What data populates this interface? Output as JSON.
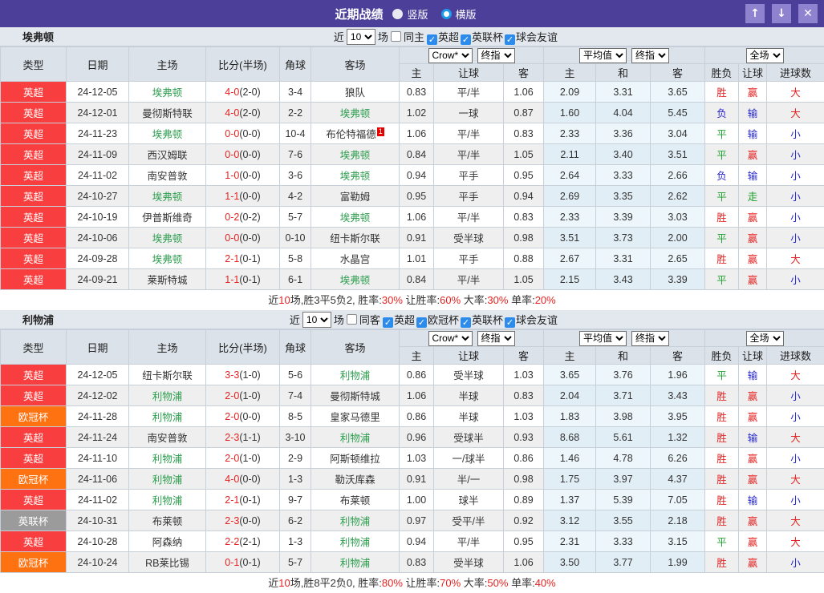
{
  "icons": {
    "check": "✓",
    "up": "↑",
    "down": "↓",
    "close": "✕"
  },
  "titlebar": {
    "title": "近期战绩",
    "radios": [
      {
        "label": "竖版",
        "selected": false
      },
      {
        "label": "横版",
        "selected": true
      }
    ],
    "buttons": {
      "up": "↑",
      "down": "↓",
      "close": "✕"
    }
  },
  "table_headers": {
    "left": [
      "类型",
      "日期",
      "主场",
      "比分(半场)",
      "角球",
      "客场"
    ],
    "odds_group": {
      "dropdown1": "Crow*",
      "dropdown2": "终指",
      "cols": [
        "主",
        "让球",
        "客"
      ]
    },
    "avg_group": {
      "dropdown1": "平均值",
      "dropdown2": "终指",
      "cols": [
        "主",
        "和",
        "客"
      ]
    },
    "result_group": {
      "dropdown": "全场",
      "cols": [
        "胜负",
        "让球",
        "进球数"
      ]
    }
  },
  "sections": [
    {
      "team": "埃弗顿",
      "controls": {
        "near_label": "近",
        "games": "10",
        "games_suffix": "场",
        "same_label": "同主",
        "same_checked": false,
        "leagues": [
          {
            "label": "英超",
            "checked": true
          },
          {
            "label": "英联杯",
            "checked": true
          },
          {
            "label": "球会友谊",
            "checked": true
          }
        ]
      },
      "rows": [
        {
          "league": "英超",
          "color": "red",
          "date": "24-12-05",
          "home": "埃弗顿",
          "hf": true,
          "score": "4-0",
          "half": "(2-0)",
          "corner": "3-4",
          "away": "狼队",
          "af": false,
          "o1": "0.83",
          "h": "平/半",
          "o2": "1.06",
          "a1": "2.09",
          "a2": "3.31",
          "a3": "3.65",
          "r1": "胜",
          "c1": "r",
          "r2": "赢",
          "c2": "r",
          "r3": "大",
          "c3": "r"
        },
        {
          "league": "英超",
          "color": "red",
          "date": "24-12-01",
          "home": "曼彻斯特联",
          "hf": false,
          "score": "4-0",
          "half": "(2-0)",
          "corner": "2-2",
          "away": "埃弗顿",
          "af": true,
          "o1": "1.02",
          "h": "一球",
          "o2": "0.87",
          "a1": "1.60",
          "a2": "4.04",
          "a3": "5.45",
          "r1": "负",
          "c1": "b",
          "r2": "输",
          "c2": "b",
          "r3": "大",
          "c3": "r"
        },
        {
          "league": "英超",
          "color": "red",
          "date": "24-11-23",
          "home": "埃弗顿",
          "hf": true,
          "score": "0-0",
          "half": "(0-0)",
          "corner": "10-4",
          "away": "布伦特福德",
          "af": false,
          "ab": "1",
          "o1": "1.06",
          "h": "平/半",
          "o2": "0.83",
          "a1": "2.33",
          "a2": "3.36",
          "a3": "3.04",
          "r1": "平",
          "c1": "g",
          "r2": "输",
          "c2": "b",
          "r3": "小",
          "c3": "b"
        },
        {
          "league": "英超",
          "color": "red",
          "date": "24-11-09",
          "home": "西汉姆联",
          "hf": false,
          "score": "0-0",
          "half": "(0-0)",
          "corner": "7-6",
          "away": "埃弗顿",
          "af": true,
          "o1": "0.84",
          "h": "平/半",
          "o2": "1.05",
          "a1": "2.11",
          "a2": "3.40",
          "a3": "3.51",
          "r1": "平",
          "c1": "g",
          "r2": "赢",
          "c2": "r",
          "r3": "小",
          "c3": "b"
        },
        {
          "league": "英超",
          "color": "red",
          "date": "24-11-02",
          "home": "南安普敦",
          "hf": false,
          "score": "1-0",
          "half": "(0-0)",
          "corner": "3-6",
          "away": "埃弗顿",
          "af": true,
          "o1": "0.94",
          "h": "平手",
          "o2": "0.95",
          "a1": "2.64",
          "a2": "3.33",
          "a3": "2.66",
          "r1": "负",
          "c1": "b",
          "r2": "输",
          "c2": "b",
          "r3": "小",
          "c3": "b"
        },
        {
          "league": "英超",
          "color": "red",
          "date": "24-10-27",
          "home": "埃弗顿",
          "hf": true,
          "score": "1-1",
          "half": "(0-0)",
          "corner": "4-2",
          "away": "富勒姆",
          "af": false,
          "o1": "0.95",
          "h": "平手",
          "o2": "0.94",
          "a1": "2.69",
          "a2": "3.35",
          "a3": "2.62",
          "r1": "平",
          "c1": "g",
          "r2": "走",
          "c2": "g",
          "r3": "小",
          "c3": "b"
        },
        {
          "league": "英超",
          "color": "red",
          "date": "24-10-19",
          "home": "伊普斯维奇",
          "hf": false,
          "score": "0-2",
          "half": "(0-2)",
          "corner": "5-7",
          "away": "埃弗顿",
          "af": true,
          "o1": "1.06",
          "h": "平/半",
          "o2": "0.83",
          "a1": "2.33",
          "a2": "3.39",
          "a3": "3.03",
          "r1": "胜",
          "c1": "r",
          "r2": "赢",
          "c2": "r",
          "r3": "小",
          "c3": "b"
        },
        {
          "league": "英超",
          "color": "red",
          "date": "24-10-06",
          "home": "埃弗顿",
          "hf": true,
          "score": "0-0",
          "half": "(0-0)",
          "corner": "0-10",
          "away": "纽卡斯尔联",
          "af": false,
          "o1": "0.91",
          "h": "受半球",
          "o2": "0.98",
          "a1": "3.51",
          "a2": "3.73",
          "a3": "2.00",
          "r1": "平",
          "c1": "g",
          "r2": "赢",
          "c2": "r",
          "r3": "小",
          "c3": "b"
        },
        {
          "league": "英超",
          "color": "red",
          "date": "24-09-28",
          "home": "埃弗顿",
          "hf": true,
          "score": "2-1",
          "half": "(0-1)",
          "corner": "5-8",
          "away": "水晶宫",
          "af": false,
          "o1": "1.01",
          "h": "平手",
          "o2": "0.88",
          "a1": "2.67",
          "a2": "3.31",
          "a3": "2.65",
          "r1": "胜",
          "c1": "r",
          "r2": "赢",
          "c2": "r",
          "r3": "大",
          "c3": "r"
        },
        {
          "league": "英超",
          "color": "red",
          "date": "24-09-21",
          "home": "莱斯特城",
          "hf": false,
          "score": "1-1",
          "half": "(0-1)",
          "corner": "6-1",
          "away": "埃弗顿",
          "af": true,
          "o1": "0.84",
          "h": "平/半",
          "o2": "1.05",
          "a1": "2.15",
          "a2": "3.43",
          "a3": "3.39",
          "r1": "平",
          "c1": "g",
          "r2": "赢",
          "c2": "r",
          "r3": "小",
          "c3": "b"
        }
      ],
      "summary": [
        [
          "近",
          "k"
        ],
        [
          "10",
          "r"
        ],
        [
          "场,胜3平5负2, 胜率:",
          "k"
        ],
        [
          "30%",
          "r"
        ],
        [
          " 让胜率:",
          "k"
        ],
        [
          "60%",
          "r"
        ],
        [
          " 大率:",
          "k"
        ],
        [
          "30%",
          "r"
        ],
        [
          " 单率:",
          "k"
        ],
        [
          "20%",
          "r"
        ]
      ]
    },
    {
      "team": "利物浦",
      "controls": {
        "near_label": "近",
        "games": "10",
        "games_suffix": "场",
        "same_label": "同客",
        "same_checked": false,
        "leagues": [
          {
            "label": "英超",
            "checked": true
          },
          {
            "label": "欧冠杯",
            "checked": true
          },
          {
            "label": "英联杯",
            "checked": true
          },
          {
            "label": "球会友谊",
            "checked": true
          }
        ]
      },
      "rows": [
        {
          "league": "英超",
          "color": "red",
          "date": "24-12-05",
          "home": "纽卡斯尔联",
          "hf": false,
          "score": "3-3",
          "half": "(1-0)",
          "corner": "5-6",
          "away": "利物浦",
          "af": true,
          "o1": "0.86",
          "h": "受半球",
          "o2": "1.03",
          "a1": "3.65",
          "a2": "3.76",
          "a3": "1.96",
          "r1": "平",
          "c1": "g",
          "r2": "输",
          "c2": "b",
          "r3": "大",
          "c3": "r"
        },
        {
          "league": "英超",
          "color": "red",
          "date": "24-12-02",
          "home": "利物浦",
          "hf": true,
          "score": "2-0",
          "half": "(1-0)",
          "corner": "7-4",
          "away": "曼彻斯特城",
          "af": false,
          "o1": "1.06",
          "h": "半球",
          "o2": "0.83",
          "a1": "2.04",
          "a2": "3.71",
          "a3": "3.43",
          "r1": "胜",
          "c1": "r",
          "r2": "赢",
          "c2": "r",
          "r3": "小",
          "c3": "b"
        },
        {
          "league": "欧冠杯",
          "color": "orange",
          "date": "24-11-28",
          "home": "利物浦",
          "hf": true,
          "score": "2-0",
          "half": "(0-0)",
          "corner": "8-5",
          "away": "皇家马德里",
          "af": false,
          "o1": "0.86",
          "h": "半球",
          "o2": "1.03",
          "a1": "1.83",
          "a2": "3.98",
          "a3": "3.95",
          "r1": "胜",
          "c1": "r",
          "r2": "赢",
          "c2": "r",
          "r3": "小",
          "c3": "b"
        },
        {
          "league": "英超",
          "color": "red",
          "date": "24-11-24",
          "home": "南安普敦",
          "hf": false,
          "score": "2-3",
          "half": "(1-1)",
          "corner": "3-10",
          "away": "利物浦",
          "af": true,
          "o1": "0.96",
          "h": "受球半",
          "o2": "0.93",
          "a1": "8.68",
          "a2": "5.61",
          "a3": "1.32",
          "r1": "胜",
          "c1": "r",
          "r2": "输",
          "c2": "b",
          "r3": "大",
          "c3": "r"
        },
        {
          "league": "英超",
          "color": "red",
          "date": "24-11-10",
          "home": "利物浦",
          "hf": true,
          "score": "2-0",
          "half": "(1-0)",
          "corner": "2-9",
          "away": "阿斯顿维拉",
          "af": false,
          "o1": "1.03",
          "h": "一/球半",
          "o2": "0.86",
          "a1": "1.46",
          "a2": "4.78",
          "a3": "6.26",
          "r1": "胜",
          "c1": "r",
          "r2": "赢",
          "c2": "r",
          "r3": "小",
          "c3": "b"
        },
        {
          "league": "欧冠杯",
          "color": "orange",
          "date": "24-11-06",
          "home": "利物浦",
          "hf": true,
          "score": "4-0",
          "half": "(0-0)",
          "corner": "1-3",
          "away": "勒沃库森",
          "af": false,
          "o1": "0.91",
          "h": "半/一",
          "o2": "0.98",
          "a1": "1.75",
          "a2": "3.97",
          "a3": "4.37",
          "r1": "胜",
          "c1": "r",
          "r2": "赢",
          "c2": "r",
          "r3": "大",
          "c3": "r"
        },
        {
          "league": "英超",
          "color": "red",
          "date": "24-11-02",
          "home": "利物浦",
          "hf": true,
          "score": "2-1",
          "half": "(0-1)",
          "corner": "9-7",
          "away": "布莱顿",
          "af": false,
          "o1": "1.00",
          "h": "球半",
          "o2": "0.89",
          "a1": "1.37",
          "a2": "5.39",
          "a3": "7.05",
          "r1": "胜",
          "c1": "r",
          "r2": "输",
          "c2": "b",
          "r3": "小",
          "c3": "b"
        },
        {
          "league": "英联杯",
          "color": "gray",
          "date": "24-10-31",
          "home": "布莱顿",
          "hf": false,
          "score": "2-3",
          "half": "(0-0)",
          "corner": "6-2",
          "away": "利物浦",
          "af": true,
          "o1": "0.97",
          "h": "受平/半",
          "o2": "0.92",
          "a1": "3.12",
          "a2": "3.55",
          "a3": "2.18",
          "r1": "胜",
          "c1": "r",
          "r2": "赢",
          "c2": "r",
          "r3": "大",
          "c3": "r"
        },
        {
          "league": "英超",
          "color": "red",
          "date": "24-10-28",
          "home": "阿森纳",
          "hf": false,
          "score": "2-2",
          "half": "(2-1)",
          "corner": "1-3",
          "away": "利物浦",
          "af": true,
          "o1": "0.94",
          "h": "平/半",
          "o2": "0.95",
          "a1": "2.31",
          "a2": "3.33",
          "a3": "3.15",
          "r1": "平",
          "c1": "g",
          "r2": "赢",
          "c2": "r",
          "r3": "大",
          "c3": "r"
        },
        {
          "league": "欧冠杯",
          "color": "orange",
          "date": "24-10-24",
          "home": "RB莱比锡",
          "hf": false,
          "score": "0-1",
          "half": "(0-1)",
          "corner": "5-7",
          "away": "利物浦",
          "af": true,
          "o1": "0.83",
          "h": "受半球",
          "o2": "1.06",
          "a1": "3.50",
          "a2": "3.77",
          "a3": "1.99",
          "r1": "胜",
          "c1": "r",
          "r2": "赢",
          "c2": "r",
          "r3": "小",
          "c3": "b"
        }
      ],
      "summary": [
        [
          "近",
          "k"
        ],
        [
          "10",
          "r"
        ],
        [
          "场,胜8平2负0, 胜率:",
          "k"
        ],
        [
          "80%",
          "r"
        ],
        [
          " 让胜率:",
          "k"
        ],
        [
          "70%",
          "r"
        ],
        [
          " 大率:",
          "k"
        ],
        [
          "50%",
          "r"
        ],
        [
          " 单率:",
          "k"
        ],
        [
          "40%",
          "r"
        ]
      ]
    }
  ]
}
